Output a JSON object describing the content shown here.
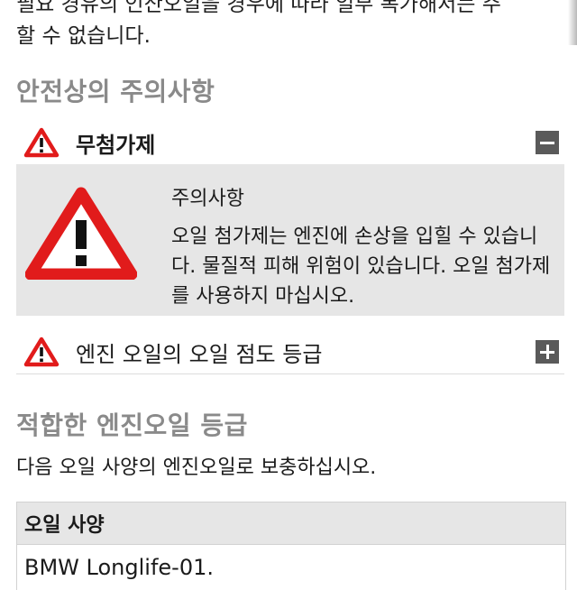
{
  "intro_text": {
    "line1": "필요 경유의 인산오일을 경우에 따라 일부 복가해서는 주",
    "line2": "할 수 없습니다."
  },
  "safety_section": {
    "heading": "안전상의 주의사항",
    "items": [
      {
        "label": "무첨가제",
        "expanded": true,
        "toggle_icon": "minus-icon"
      },
      {
        "label": "엔진 오일의 오일 점도 등급",
        "expanded": false,
        "toggle_icon": "plus-icon"
      }
    ],
    "warning": {
      "title": "주의사항",
      "body": "오일 첨가제는 엔진에 손상을 입힐 수 있습니다. 물질적 피해 위험이 있습니다. 오일 첨가제를 사용하지 마십시오."
    }
  },
  "oil_section": {
    "heading": "적합한 엔진오일 등급",
    "description": "다음 오일 사양의 엔진오일로 보충하십시오.",
    "table": {
      "header": "오일 사양",
      "rows": [
        "BMW Longlife-01."
      ]
    }
  },
  "colors": {
    "warning_red": "#e11b1b",
    "heading_gray": "#8a8a8a",
    "panel_gray": "#e6e6e6",
    "toggle_gray": "#5a5a5a"
  }
}
